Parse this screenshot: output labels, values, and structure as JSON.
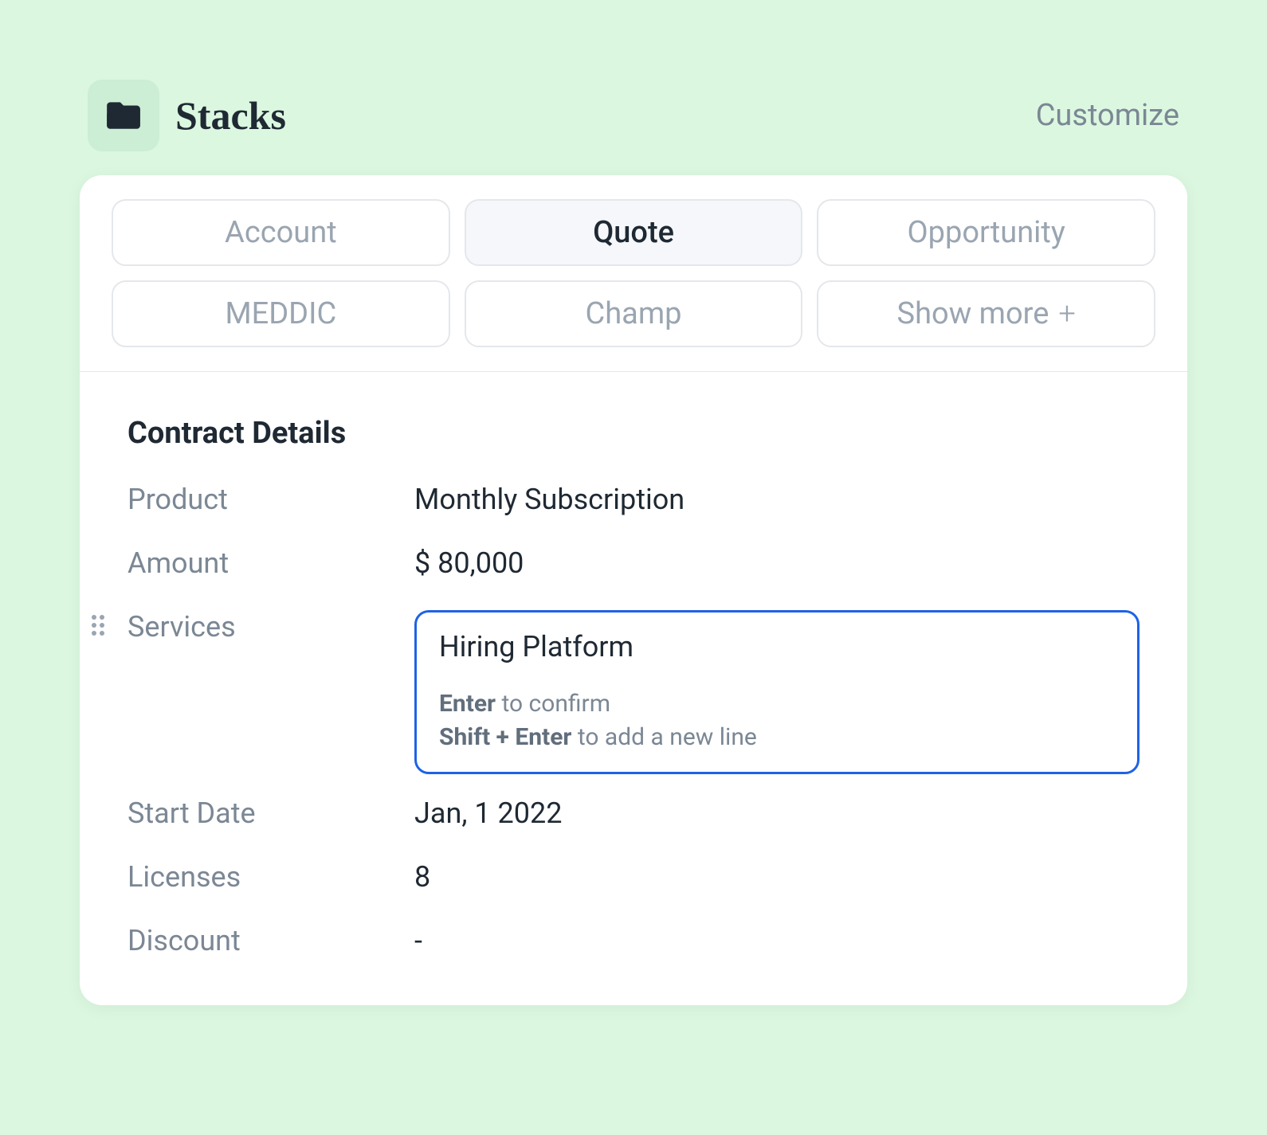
{
  "header": {
    "app_name": "Stacks",
    "customize_label": "Customize"
  },
  "tabs": [
    {
      "label": "Account",
      "active": false
    },
    {
      "label": "Quote",
      "active": true
    },
    {
      "label": "Opportunity",
      "active": false
    },
    {
      "label": "MEDDIC",
      "active": false
    },
    {
      "label": "Champ",
      "active": false
    },
    {
      "label": "Show more",
      "active": false,
      "has_plus": true
    }
  ],
  "section": {
    "title": "Contract Details",
    "fields": {
      "product": {
        "label": "Product",
        "value": "Monthly Subscription"
      },
      "amount": {
        "label": "Amount",
        "value": "$ 80,000"
      },
      "services": {
        "label": "Services",
        "value": "Hiring Platform",
        "editing": true,
        "hints": {
          "enter_key": "Enter",
          "enter_text": " to confirm",
          "shift_enter_key": "Shift + Enter",
          "shift_enter_text": " to add a new line"
        }
      },
      "start_date": {
        "label": "Start Date",
        "value": "Jan, 1 2022"
      },
      "licenses": {
        "label": "Licenses",
        "value": "8"
      },
      "discount": {
        "label": "Discount",
        "value": "-"
      }
    }
  }
}
